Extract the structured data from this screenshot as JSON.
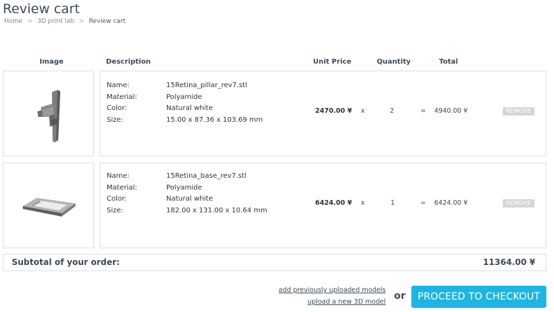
{
  "page": {
    "title": "Review cart"
  },
  "breadcrumb": {
    "items": [
      "Home",
      "3D print lab"
    ],
    "separator": ">",
    "current": "Review cart"
  },
  "table": {
    "headers": {
      "image": "Image",
      "description": "Description",
      "unit_price": "Unit Price",
      "quantity": "Quantity",
      "total": "Total"
    },
    "spec_labels": {
      "name": "Name:",
      "material": "Material:",
      "color": "Color:",
      "size": "Size:"
    },
    "multiply_sign": "x",
    "equals_sign": "=",
    "remove_label": "REMOVE"
  },
  "items": [
    {
      "image_icon": "pillar-model-thumbnail",
      "name": "15Retina_pillar_rev7.stl",
      "material": "Polyamide",
      "color": "Natural white",
      "size": "15.00 x 87.36 x 103.69 mm",
      "unit_price": "2470.00 ¥",
      "quantity": "2",
      "total": "4940.00 ¥"
    },
    {
      "image_icon": "base-model-thumbnail",
      "name": "15Retina_base_rev7.stl",
      "material": "Polyamide",
      "color": "Natural white",
      "size": "182.00 x 131.00 x 10.64 mm",
      "unit_price": "6424.00 ¥",
      "quantity": "1",
      "total": "6424.00 ¥"
    }
  ],
  "subtotal": {
    "label": "Subtotal of your order:",
    "value": "11364.00 ¥"
  },
  "actions": {
    "add_previous": "add previously uploaded models",
    "upload_new": "upload a new 3D model",
    "or": "or",
    "checkout": "PROCEED TO CHECKOUT"
  },
  "colors": {
    "accent": "#1fb5e0",
    "heading": "#3d4a57",
    "remove_button": "#d6d6d6",
    "border": "#dddddd"
  }
}
